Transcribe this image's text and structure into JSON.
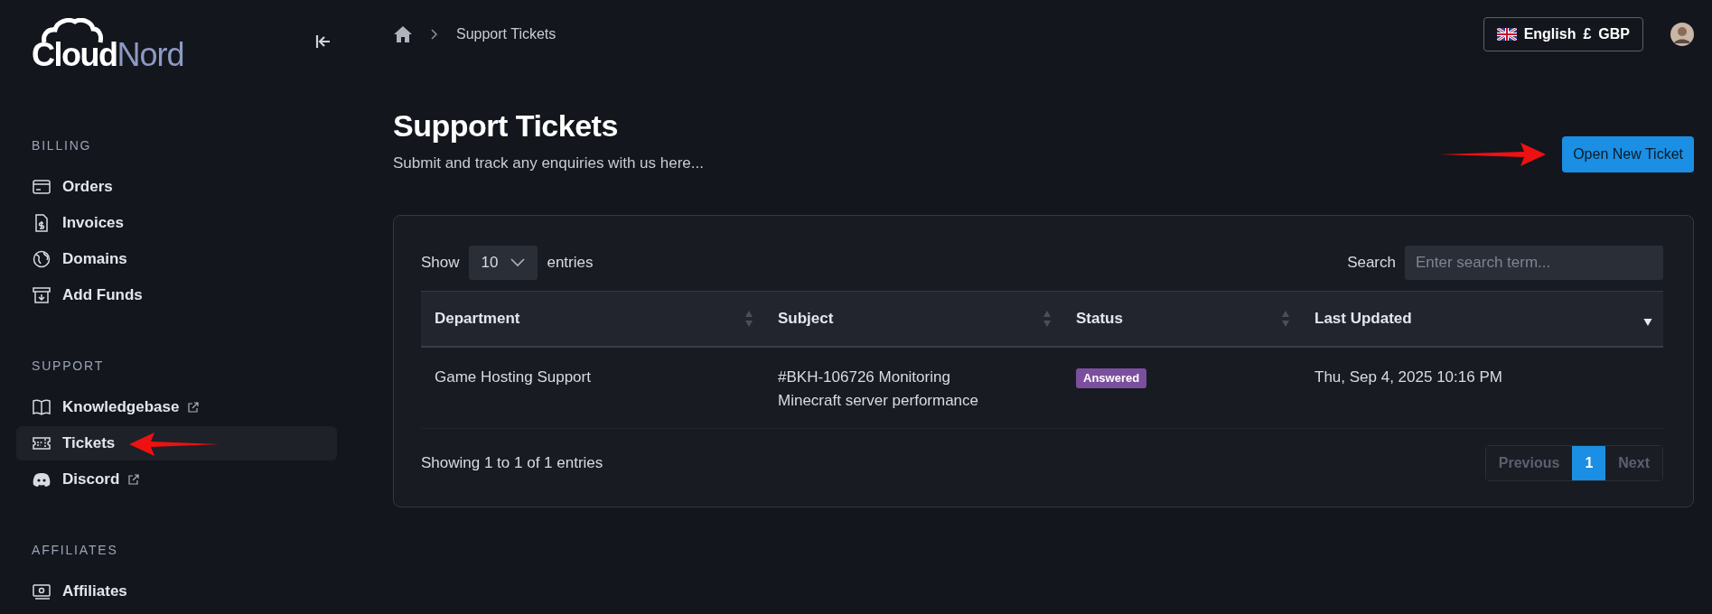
{
  "logo": {
    "part_1": "Cloud",
    "part_2": "Nord"
  },
  "sidebar": {
    "sections": [
      {
        "title": "BILLING",
        "items": [
          {
            "label": "Orders",
            "selected": false,
            "external": false
          },
          {
            "label": "Invoices",
            "selected": false,
            "external": false
          },
          {
            "label": "Domains",
            "selected": false,
            "external": false
          },
          {
            "label": "Add Funds",
            "selected": false,
            "external": false
          }
        ]
      },
      {
        "title": "SUPPORT",
        "items": [
          {
            "label": "Knowledgebase",
            "selected": false,
            "external": true
          },
          {
            "label": "Tickets",
            "selected": true,
            "external": false
          },
          {
            "label": "Discord",
            "selected": false,
            "external": true
          }
        ]
      },
      {
        "title": "AFFILIATES",
        "items": [
          {
            "label": "Affiliates",
            "selected": false,
            "external": false
          }
        ]
      }
    ]
  },
  "breadcrumb": {
    "current": "Support Tickets"
  },
  "locale_button": {
    "language": "English",
    "currency_symbol": "£",
    "currency": "GBP"
  },
  "page": {
    "title": "Support Tickets",
    "subtitle": "Submit and track any enquiries with us here...",
    "action_button": "Open New Ticket"
  },
  "table_controls": {
    "show_label": "Show",
    "page_size": "10",
    "entries_label": "entries",
    "search_label": "Search",
    "search_placeholder": "Enter search term..."
  },
  "table": {
    "columns": [
      {
        "label": "Department",
        "sorted": false
      },
      {
        "label": "Subject",
        "sorted": false
      },
      {
        "label": "Status",
        "sorted": false
      },
      {
        "label": "Last Updated",
        "sorted": true
      }
    ],
    "rows": [
      {
        "department": "Game Hosting Support",
        "subject_line_1": "#BKH-106726 Monitoring",
        "subject_line_2": "Minecraft server performance",
        "status": "Answered",
        "color": "#7b4f9e",
        "last_updated": "Thu, Sep 4, 2025 10:16 PM"
      }
    ]
  },
  "footer": {
    "summary": "Showing 1 to 1 of 1 entries"
  },
  "pagination": [
    {
      "label": "Previous",
      "disabled": true,
      "selected": false
    },
    {
      "label": "1",
      "disabled": false,
      "selected": true
    },
    {
      "label": "Next",
      "disabled": true,
      "selected": false
    }
  ]
}
